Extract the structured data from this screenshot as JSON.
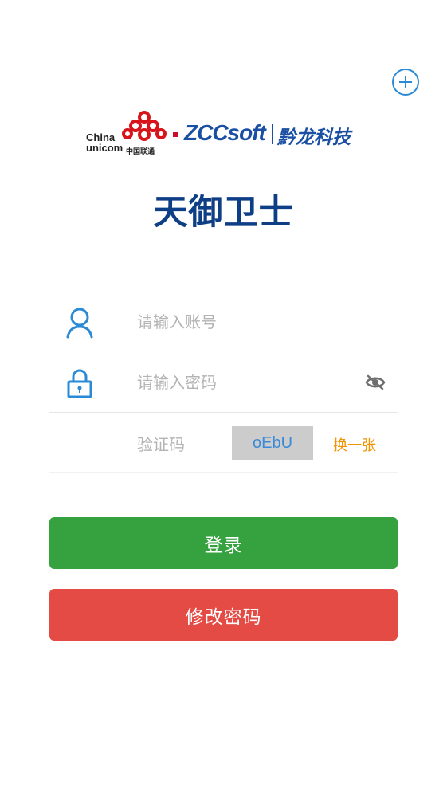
{
  "brand": {
    "china_unicom_en_line1": "China",
    "china_unicom_en_line2": "unicom",
    "china_unicom_cn": "中国联通",
    "zcc_logo": "ZCCsoft",
    "zcc_cn": "黔龙科技"
  },
  "app_title": "天御卫士",
  "form": {
    "account": {
      "placeholder": "请输入账号",
      "value": "",
      "icon": "user-icon"
    },
    "password": {
      "placeholder": "请输入密码",
      "value": "",
      "icon": "lock-icon",
      "toggle_icon": "eye-hidden-icon"
    },
    "captcha": {
      "label": "验证码",
      "code": "oEbU",
      "refresh_label": "换一张"
    }
  },
  "buttons": {
    "login": "登录",
    "change_password": "修改密码"
  },
  "colors": {
    "accent_blue": "#2b8ad6",
    "title_blue": "#0e3f86",
    "login_green": "#36a23f",
    "change_red": "#e34b44",
    "refresh_orange": "#f29300"
  }
}
